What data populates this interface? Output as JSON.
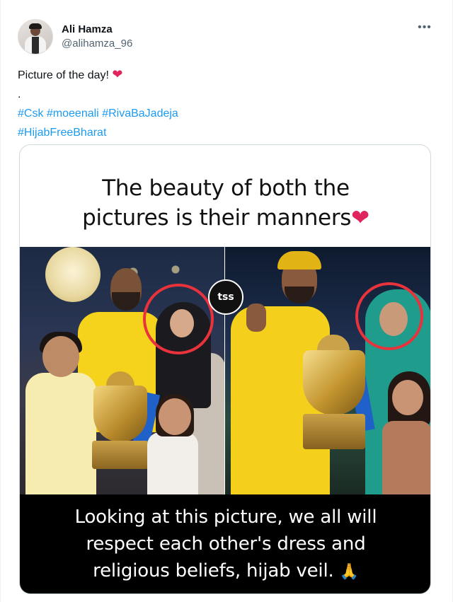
{
  "tweet": {
    "author": {
      "display_name": "Ali Hamza",
      "handle": "@alihamza_96"
    },
    "more_icon": "ellipsis-icon",
    "text_line1": "Picture of the day!",
    "heart_glyph": "❤",
    "dot_line": ".",
    "hashtags_line1": [
      "#Csk",
      "#moeenali",
      "#RivaBaJadeja"
    ],
    "hashtags_line2": [
      "#HijabFreeBharat"
    ]
  },
  "media": {
    "headline_line1": "The beauty of both the",
    "headline_line2": "pictures is their manners",
    "headline_heart": "❤",
    "badge_text": "tss",
    "caption_line1": "Looking at this picture, we all will",
    "caption_line2": "respect each other's dress and",
    "caption_line3": "religious beliefs, hijab veil.",
    "caption_emoji": "🙏"
  },
  "colors": {
    "hashtag": "#1d9bf0",
    "heart": "#e0245e",
    "circle": "#e8323c",
    "jersey": "#f4cf1c"
  }
}
